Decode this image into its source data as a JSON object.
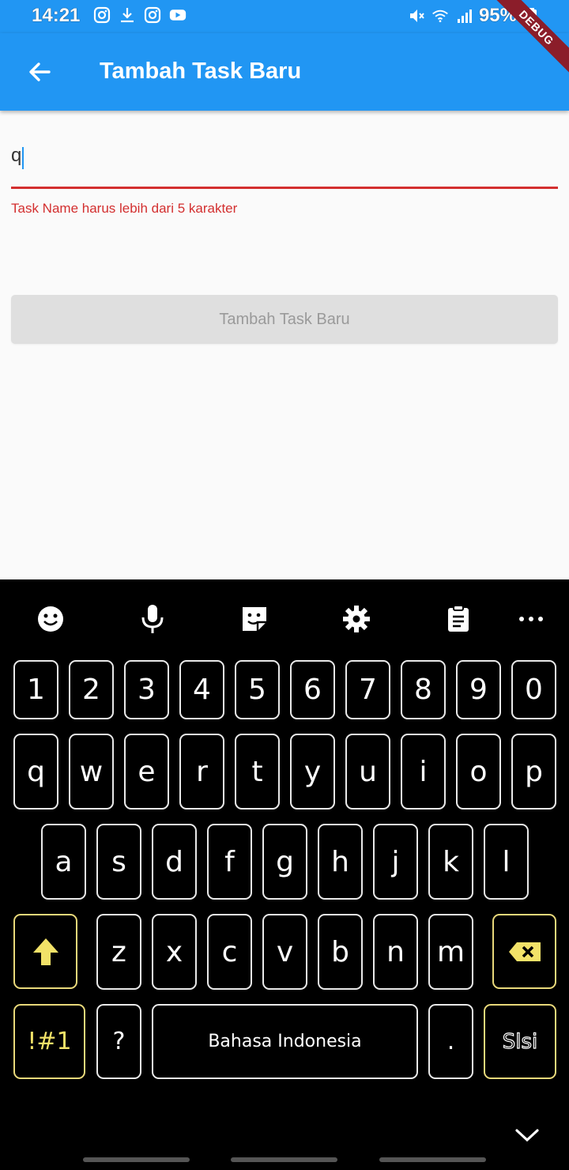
{
  "status_bar": {
    "time": "14:21",
    "battery": "95%",
    "left_icons": [
      "instagram-icon",
      "download-icon",
      "instagram-icon",
      "youtube-icon"
    ],
    "right_icons": [
      "mute-icon",
      "wifi-icon",
      "signal-icon",
      "battery-icon"
    ]
  },
  "debug_banner": "DEBUG",
  "app_bar": {
    "title": "Tambah Task Baru",
    "back_icon": "arrow-left-icon"
  },
  "form": {
    "task_name_value": "q",
    "error_text": "Task Name harus lebih dari 5 karakter",
    "submit_label": "Tambah Task Baru"
  },
  "keyboard": {
    "toolbar": [
      "emoji-icon",
      "microphone-icon",
      "sticker-icon",
      "settings-icon",
      "clipboard-icon",
      "more-icon"
    ],
    "row_numbers": [
      "1",
      "2",
      "3",
      "4",
      "5",
      "6",
      "7",
      "8",
      "9",
      "0"
    ],
    "row_1": [
      "q",
      "w",
      "e",
      "r",
      "t",
      "y",
      "u",
      "i",
      "o",
      "p"
    ],
    "row_2": [
      "a",
      "s",
      "d",
      "f",
      "g",
      "h",
      "j",
      "k",
      "l"
    ],
    "row_3": [
      "z",
      "x",
      "c",
      "v",
      "b",
      "n",
      "m"
    ],
    "symbols_label": "!#1",
    "question_label": "?",
    "space_label": "Bahasa Indonesia",
    "period_label": ".",
    "action_label": "Slsi",
    "colors": {
      "accent": "#f2e268",
      "key_border": "#e9e9e9",
      "background": "#000000"
    }
  },
  "colors": {
    "primary": "#2196f3",
    "error": "#d32f2f",
    "button_disabled": "#dfdfdf"
  }
}
